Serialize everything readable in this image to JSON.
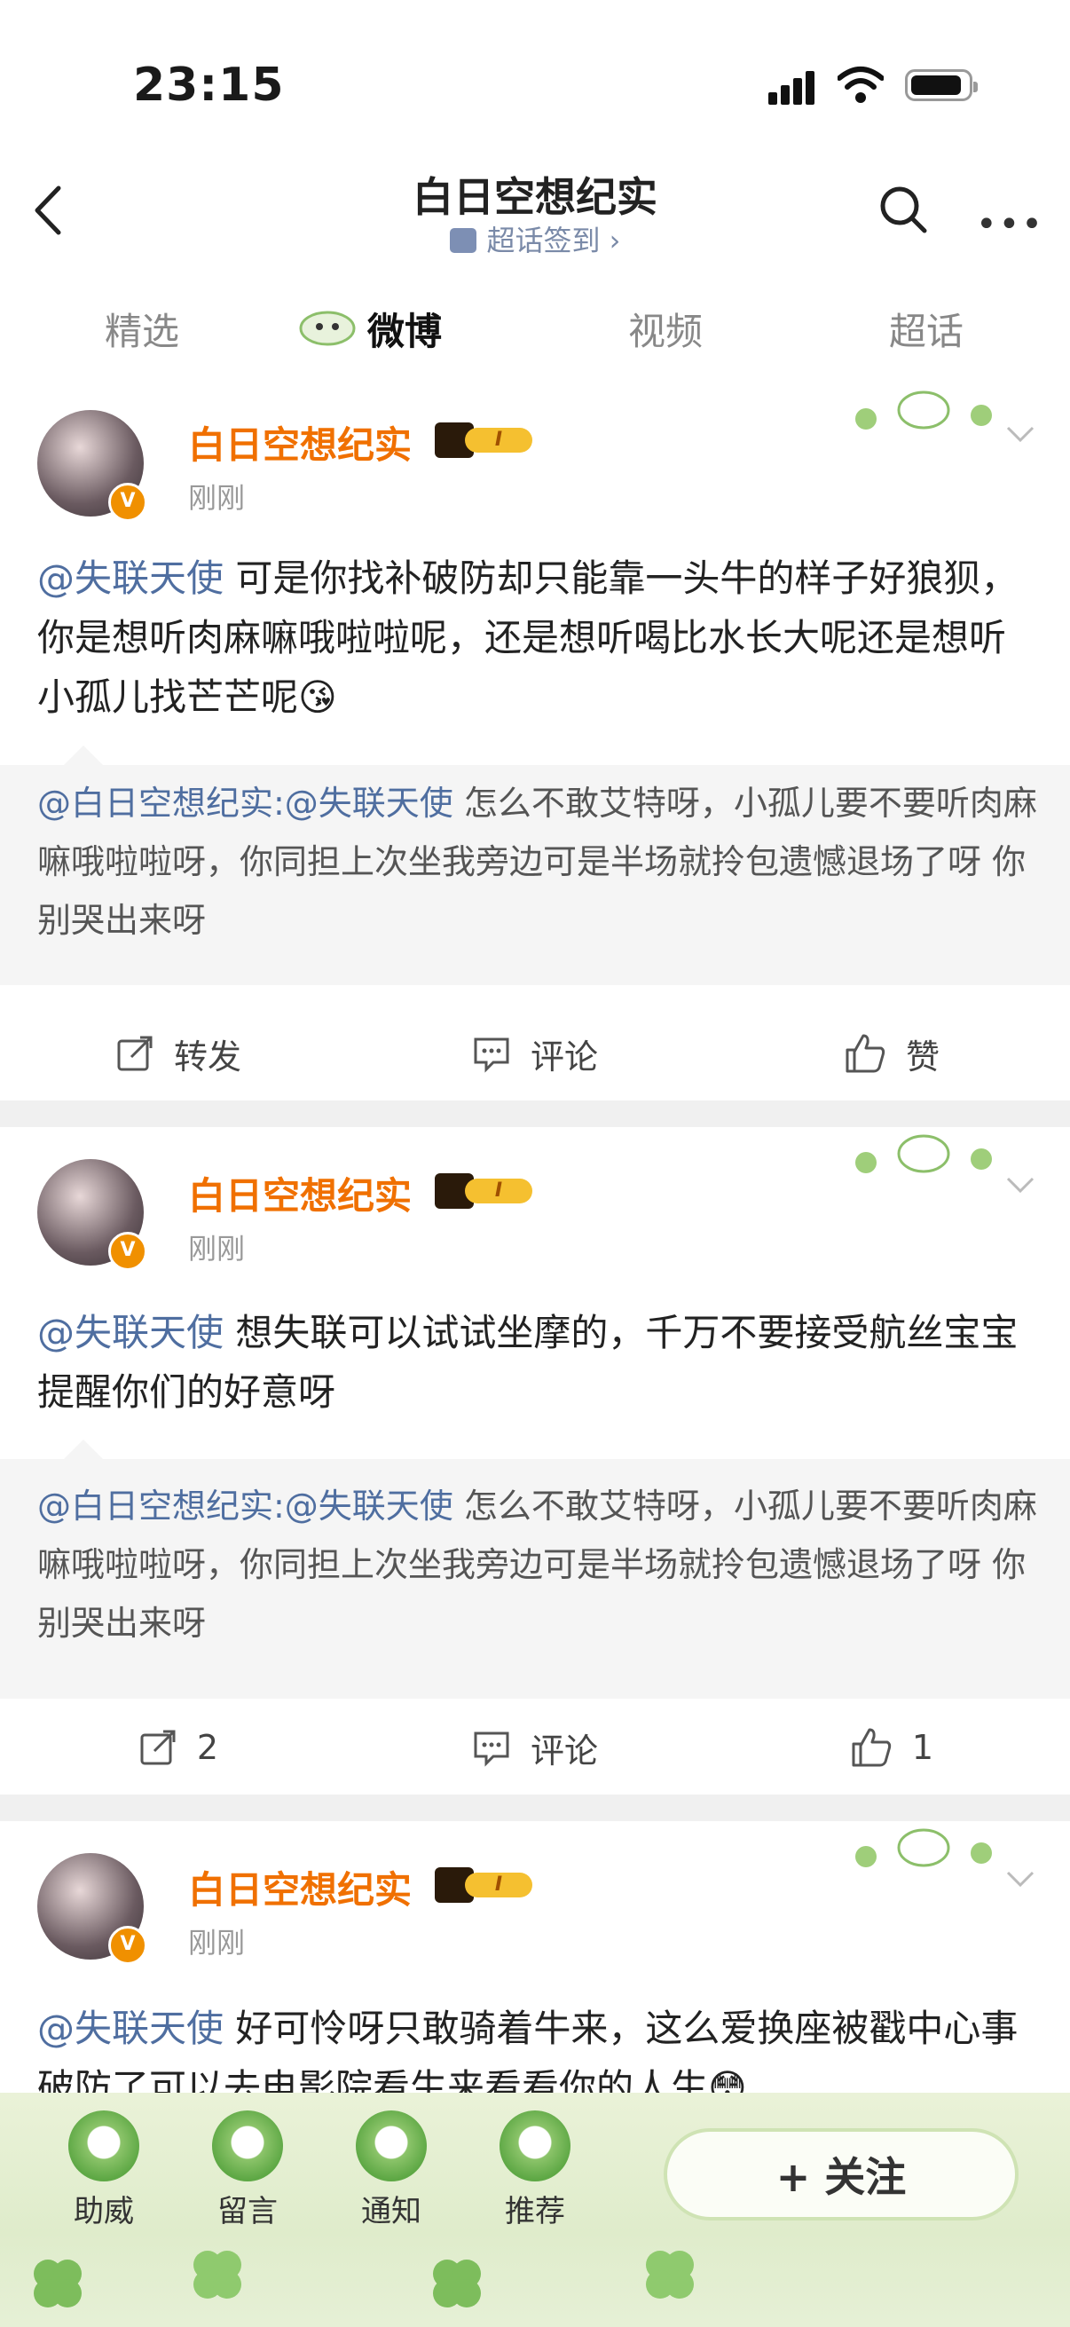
{
  "status_bar": {
    "time": "23:15"
  },
  "nav": {
    "title": "白日空想纪实",
    "signin_label": "超话签到 ›"
  },
  "tabs": [
    {
      "label": "精选"
    },
    {
      "label": "微博"
    },
    {
      "label": "视频"
    },
    {
      "label": "超话"
    }
  ],
  "posts": [
    {
      "author": "白日空想纪实",
      "level": "I",
      "time": "刚刚",
      "mention": "@失联天使",
      "text": " 可是你找补破防却只能靠一头牛的样子好狼狈，你是想听肉麻嘛哦啦啦呢，还是想听喝比水长大呢还是想听小孤儿找芒芒呢😘",
      "quote_mention": "@白日空想纪实:@失联天使",
      "quote_text": " 怎么不敢艾特呀，小孤儿要不要听肉麻嘛哦啦啦呀，你同担上次坐我旁边可是半场就拎包遗憾退场了呀 你别哭出来呀",
      "repost_label": "转发",
      "comment_label": "评论",
      "like_label": "赞"
    },
    {
      "author": "白日空想纪实",
      "level": "I",
      "time": "刚刚",
      "mention": "@失联天使",
      "text": " 想失联可以试试坐摩的，千万不要接受航丝宝宝提醒你们的好意呀",
      "quote_mention": "@白日空想纪实:@失联天使",
      "quote_text": " 怎么不敢艾特呀，小孤儿要不要听肉麻嘛哦啦啦呀，你同担上次坐我旁边可是半场就拎包遗憾退场了呀 你别哭出来呀",
      "repost_label": "2",
      "comment_label": "评论",
      "like_label": "1"
    },
    {
      "author": "白日空想纪实",
      "level": "I",
      "time": "刚刚",
      "mention": "@失联天使",
      "text": " 好可怜呀只敢骑着牛来，这么爱换座被戳中心事破防了可以去电影院看生来看看你的人生😳"
    }
  ],
  "bottom_bar": {
    "items": [
      {
        "label": "助威"
      },
      {
        "label": "留言"
      },
      {
        "label": "通知"
      },
      {
        "label": "推荐"
      }
    ],
    "follow_label": "+ 关注"
  },
  "colors": {
    "username": "#f07000",
    "mention": "#4f6ea0",
    "quote_bg": "#f5f5f5"
  }
}
